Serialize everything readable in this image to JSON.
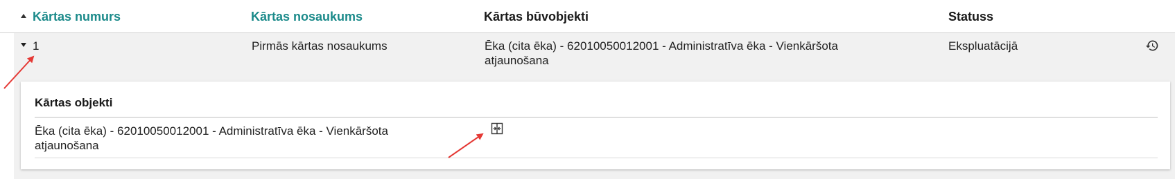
{
  "table": {
    "columns": [
      {
        "label": "Kārtas numurs",
        "sortable": true,
        "sort": "ascending"
      },
      {
        "label": "Kārtas nosaukums",
        "sortable": true
      },
      {
        "label": "Kārtas būvobjekti",
        "sortable": false
      },
      {
        "label": "Statuss",
        "sortable": false
      }
    ],
    "rows": [
      {
        "number": "1",
        "name": "Pirmās kārtas nosaukums",
        "objects": "Ēka (cita ēka) - 62010050012001 - Administratīva ēka - Vienkāršota atjaunošana",
        "status": "Ekspluatācijā",
        "expanded": true,
        "history_icon": "history-icon",
        "detail": {
          "title": "Kārtas objekti",
          "items": [
            {
              "text": "Ēka (cita ēka) - 62010050012001 - Administratīva ēka - Vienkāršota atjaunošana",
              "action_icon": "compare-icon"
            }
          ]
        }
      }
    ]
  },
  "colors": {
    "accent": "#1b8a8a",
    "row_bg": "#f1f1f1",
    "annotation_arrow": "#e53935"
  }
}
